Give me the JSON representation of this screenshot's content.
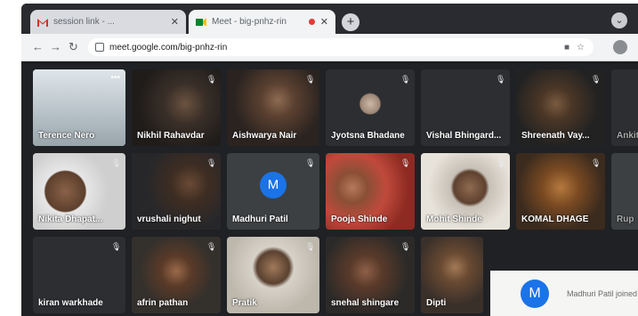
{
  "browser": {
    "tabs": [
      {
        "title": "session link - ...",
        "favicon": "gmail-icon"
      },
      {
        "title": "Meet - big-pnhz-rin",
        "favicon": "meet-icon"
      }
    ],
    "url": "meet.google.com/big-pnhz-rin"
  },
  "meeting": {
    "participants": [
      {
        "name": "Terence Nero",
        "muted": false
      },
      {
        "name": "Nikhil Rahavdar",
        "muted": true
      },
      {
        "name": "Aishwarya Nair",
        "muted": true
      },
      {
        "name": "Jyotsna Bhadane",
        "muted": true
      },
      {
        "name": "Vishal Bhingard...",
        "muted": true
      },
      {
        "name": "Shreenath Vay...",
        "muted": true
      },
      {
        "name": "Ankit",
        "muted": true
      },
      {
        "name": "Nikita Dhapat...",
        "muted": true
      },
      {
        "name": "vrushali nighut",
        "muted": true
      },
      {
        "name": "Madhuri Patil",
        "muted": true,
        "initial": "M"
      },
      {
        "name": "Pooja Shinde",
        "muted": true
      },
      {
        "name": "Mohit Shinde",
        "muted": true
      },
      {
        "name": "KOMAL DHAGE",
        "muted": true
      },
      {
        "name": "Rup",
        "muted": true
      },
      {
        "name": "kiran warkhade",
        "muted": true
      },
      {
        "name": "afrin pathan",
        "muted": true
      },
      {
        "name": "Pratik",
        "muted": true
      },
      {
        "name": "snehal shingare",
        "muted": true
      },
      {
        "name": "Dipti",
        "muted": true
      }
    ],
    "notification": {
      "initial": "M",
      "text": "Madhuri Patil joined"
    }
  },
  "colors": {
    "accent": "#1a73e8",
    "background": "#202124"
  }
}
